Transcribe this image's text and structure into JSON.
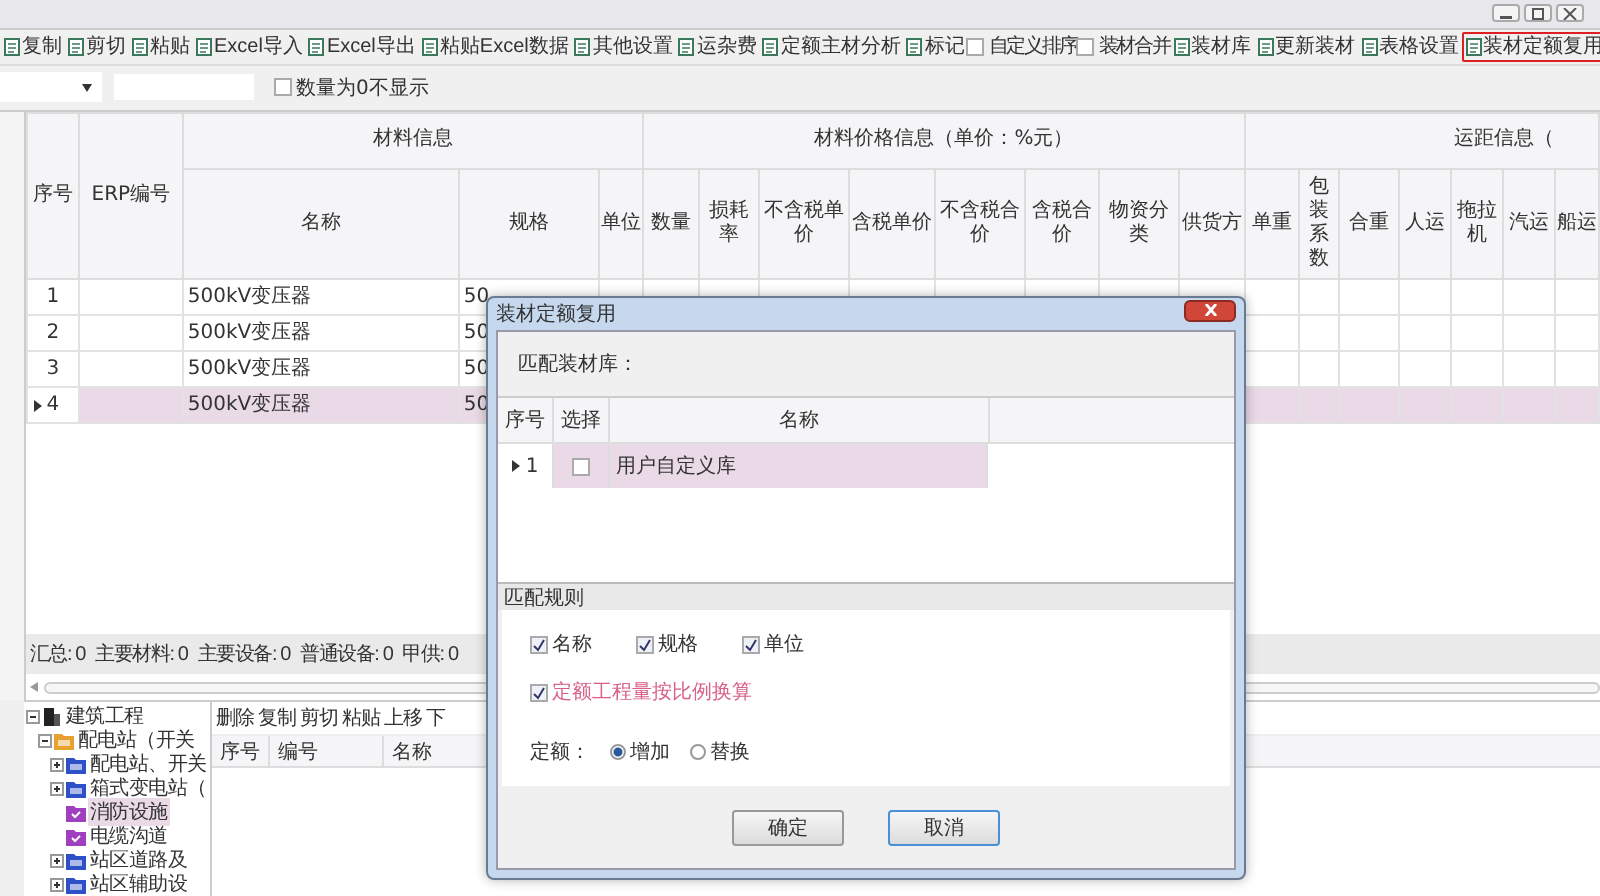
{
  "toolbar": [
    {
      "kind": "button",
      "label": "复制",
      "highlighted": false
    },
    {
      "kind": "button",
      "label": "剪切",
      "highlighted": false
    },
    {
      "kind": "button",
      "label": "粘贴",
      "highlighted": false
    },
    {
      "kind": "button",
      "label": "Excel导入",
      "highlighted": false
    },
    {
      "kind": "button",
      "label": "Excel导出",
      "highlighted": false
    },
    {
      "kind": "button",
      "label": "粘贴Excel数据",
      "highlighted": false
    },
    {
      "kind": "button",
      "label": "其他设置",
      "highlighted": false
    },
    {
      "kind": "button",
      "label": "运杂费",
      "highlighted": false
    },
    {
      "kind": "button",
      "label": "定额主材分析",
      "highlighted": false
    },
    {
      "kind": "button",
      "label": "标记",
      "highlighted": false
    },
    {
      "kind": "checkbox",
      "label": "自定义排序",
      "checked": false
    },
    {
      "kind": "checkbox",
      "label": "装材合并",
      "checked": false
    },
    {
      "kind": "button",
      "label": "装材库",
      "highlighted": false
    },
    {
      "kind": "button",
      "label": "更新装材",
      "highlighted": false
    },
    {
      "kind": "button",
      "label": "表格设置",
      "highlighted": false
    },
    {
      "kind": "button",
      "label": "装材定额复用",
      "highlighted": true
    }
  ],
  "filter_bar": {
    "checkbox": {
      "label": "数量为0不显示",
      "checked": false
    }
  },
  "table": {
    "leading_columns": [
      "序号",
      "ERP编号"
    ],
    "groups": [
      {
        "label": "材料信息",
        "columns": [
          "名称",
          "规格",
          "单位"
        ]
      },
      {
        "label": "材料价格信息（单价：%元）",
        "columns": [
          "数量",
          "损耗率",
          "不含税单价",
          "含税单价",
          "不含税合价",
          "含税合价",
          "物资分类",
          "供货方"
        ]
      },
      {
        "label": "运距信息（",
        "columns": [
          "单重",
          "包装系数",
          "合重",
          "人运",
          "拖拉机",
          "汽运",
          "船运"
        ]
      }
    ],
    "rows": [
      {
        "number": "1",
        "name": "500kV变压器",
        "spec": "50",
        "selected": false
      },
      {
        "number": "2",
        "name": "500kV变压器",
        "spec": "50",
        "selected": false
      },
      {
        "number": "3",
        "name": "500kV变压器",
        "spec": "50",
        "selected": false
      },
      {
        "number": "4",
        "name": "500kV变压器",
        "spec": "50",
        "selected": true
      }
    ]
  },
  "summary": [
    "汇总: 0",
    "主要材料: 0",
    "主要设备: 0",
    "普通设备: 0",
    "甲供: 0"
  ],
  "tree": [
    {
      "label": "建筑工程",
      "kind": "root",
      "expanded": true,
      "selected": false,
      "children": [
        {
          "label": "配电站（开关",
          "kind": "folder",
          "expanded": true,
          "selected": false,
          "children": [
            {
              "label": "配电站、开关",
              "kind": "folder",
              "expanded": false,
              "selected": false
            },
            {
              "label": "箱式变电站（",
              "kind": "folder",
              "expanded": false,
              "selected": false
            },
            {
              "label": "消防设施",
              "kind": "leaf",
              "selected": true
            },
            {
              "label": "电缆沟道",
              "kind": "leaf",
              "selected": false
            },
            {
              "label": "站区道路及",
              "kind": "folder",
              "expanded": false,
              "selected": false
            },
            {
              "label": "站区辅助设",
              "kind": "folder",
              "expanded": false,
              "selected": false
            }
          ]
        }
      ]
    }
  ],
  "detail_toolbar": [
    "删除",
    "复制",
    "剪切",
    "粘贴",
    "上移",
    "下"
  ],
  "detail_columns": [
    "序号",
    "编号",
    "名称"
  ],
  "dialog": {
    "title": "装材定额复用",
    "library_label": "匹配装材库：",
    "library_columns": [
      "序号",
      "选择",
      "名称"
    ],
    "library_rows": [
      {
        "number": "1",
        "checked": false,
        "name": "用户自定义库",
        "selected": true
      }
    ],
    "rules_title": "匹配规则",
    "rules": [
      {
        "label": "名称",
        "checked": true
      },
      {
        "label": "规格",
        "checked": true
      },
      {
        "label": "单位",
        "checked": true
      }
    ],
    "scale_option": {
      "label": "定额工程量按比例换算",
      "checked": true
    },
    "quota_label": "定额：",
    "quota_options": [
      {
        "label": "增加",
        "selected": true
      },
      {
        "label": "替换",
        "selected": false
      }
    ],
    "buttons": [
      {
        "label": "确定",
        "focused": false
      },
      {
        "label": "取消",
        "focused": true
      }
    ]
  }
}
